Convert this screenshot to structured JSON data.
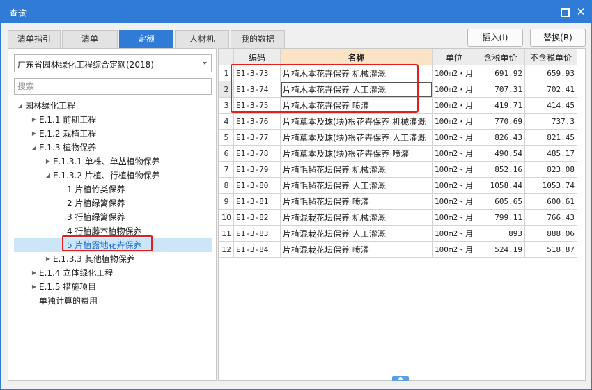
{
  "window": {
    "title": "查询",
    "close_glyph": "✕"
  },
  "tabs": [
    {
      "label": "清单指引",
      "active": false
    },
    {
      "label": "清单",
      "active": false
    },
    {
      "label": "定额",
      "active": true
    },
    {
      "label": "人材机",
      "active": false
    },
    {
      "label": "我的数据",
      "active": false
    }
  ],
  "toolbar": {
    "insert_label": "插入(I)",
    "replace_label": "替换(R)"
  },
  "left": {
    "dropdown_value": "广东省园林绿化工程综合定额(2018)",
    "search_placeholder": "搜索",
    "tree": [
      {
        "label": "园林绿化工程",
        "expander": "◢"
      },
      {
        "label": "E.1.1 前期工程",
        "expander": "▶"
      },
      {
        "label": "E.1.2 栽植工程",
        "expander": "▶"
      },
      {
        "label": "E.1.3 植物保养",
        "expander": "◢"
      },
      {
        "label": "E.1.3.1 单株、单丛植物保养",
        "expander": "▶"
      },
      {
        "label": "E.1.3.2 片植、行植植物保养",
        "expander": "◢"
      },
      {
        "label": "1 片植竹类保养",
        "expander": ""
      },
      {
        "label": "2 片植绿篱保养",
        "expander": ""
      },
      {
        "label": "3 行植绿篱保养",
        "expander": ""
      },
      {
        "label": "4 行植藤本植物保养",
        "expander": ""
      },
      {
        "label": "5 片植露地花卉保养",
        "expander": "",
        "selected": true
      },
      {
        "label": "E.1.3.3 其他植物保养",
        "expander": "▶"
      },
      {
        "label": "E.1.4 立体绿化工程",
        "expander": "▶"
      },
      {
        "label": "E.1.5 措施项目",
        "expander": "▶"
      },
      {
        "label": "单独计算的费用",
        "expander": ""
      }
    ]
  },
  "grid": {
    "headers": [
      "",
      "编码",
      "名称",
      "单位",
      "含税单价",
      "不含税单价"
    ],
    "rows": [
      {
        "idx": "1",
        "code": "E1-3-73",
        "name": "片植木本花卉保养 机械灌溉",
        "unit": "100m2・月",
        "price_tax": "691.92",
        "price_notax": "659.93"
      },
      {
        "idx": "2",
        "code": "E1-3-74",
        "name": "片植木本花卉保养 人工灌溉",
        "unit": "100m2・月",
        "price_tax": "707.31",
        "price_notax": "702.41",
        "focus": true
      },
      {
        "idx": "3",
        "code": "E1-3-75",
        "name": "片植木本花卉保养 喷灌",
        "unit": "100m2・月",
        "price_tax": "419.71",
        "price_notax": "414.45"
      },
      {
        "idx": "4",
        "code": "E1-3-76",
        "name": "片植草本及球(块)根花卉保养 机械灌溉",
        "unit": "100m2・月",
        "price_tax": "770.69",
        "price_notax": "737.3"
      },
      {
        "idx": "5",
        "code": "E1-3-77",
        "name": "片植草本及球(块)根花卉保养 人工灌溉",
        "unit": "100m2・月",
        "price_tax": "826.43",
        "price_notax": "821.45"
      },
      {
        "idx": "6",
        "code": "E1-3-78",
        "name": "片植草本及球(块)根花卉保养 喷灌",
        "unit": "100m2・月",
        "price_tax": "490.54",
        "price_notax": "485.17"
      },
      {
        "idx": "7",
        "code": "E1-3-79",
        "name": "片植毛毡花坛保养 机械灌溉",
        "unit": "100m2・月",
        "price_tax": "852.16",
        "price_notax": "823.08"
      },
      {
        "idx": "8",
        "code": "E1-3-80",
        "name": "片植毛毡花坛保养 人工灌溉",
        "unit": "100m2・月",
        "price_tax": "1058.44",
        "price_notax": "1053.74"
      },
      {
        "idx": "9",
        "code": "E1-3-81",
        "name": "片植毛毡花坛保养 喷灌",
        "unit": "100m2・月",
        "price_tax": "605.65",
        "price_notax": "600.61"
      },
      {
        "idx": "10",
        "code": "E1-3-82",
        "name": "片植混栽花坛保养 机械灌溉",
        "unit": "100m2・月",
        "price_tax": "799.11",
        "price_notax": "766.43"
      },
      {
        "idx": "11",
        "code": "E1-3-83",
        "name": "片植混栽花坛保养 人工灌溉",
        "unit": "100m2・月",
        "price_tax": "893",
        "price_notax": "888.06"
      },
      {
        "idx": "12",
        "code": "E1-3-84",
        "name": "片植混栽花坛保养 喷灌",
        "unit": "100m2・月",
        "price_tax": "524.19",
        "price_notax": "518.87"
      }
    ]
  },
  "colors": {
    "accent": "#2f7bd6",
    "highlight": "#e02020",
    "selected_bg": "#cde6f7"
  }
}
